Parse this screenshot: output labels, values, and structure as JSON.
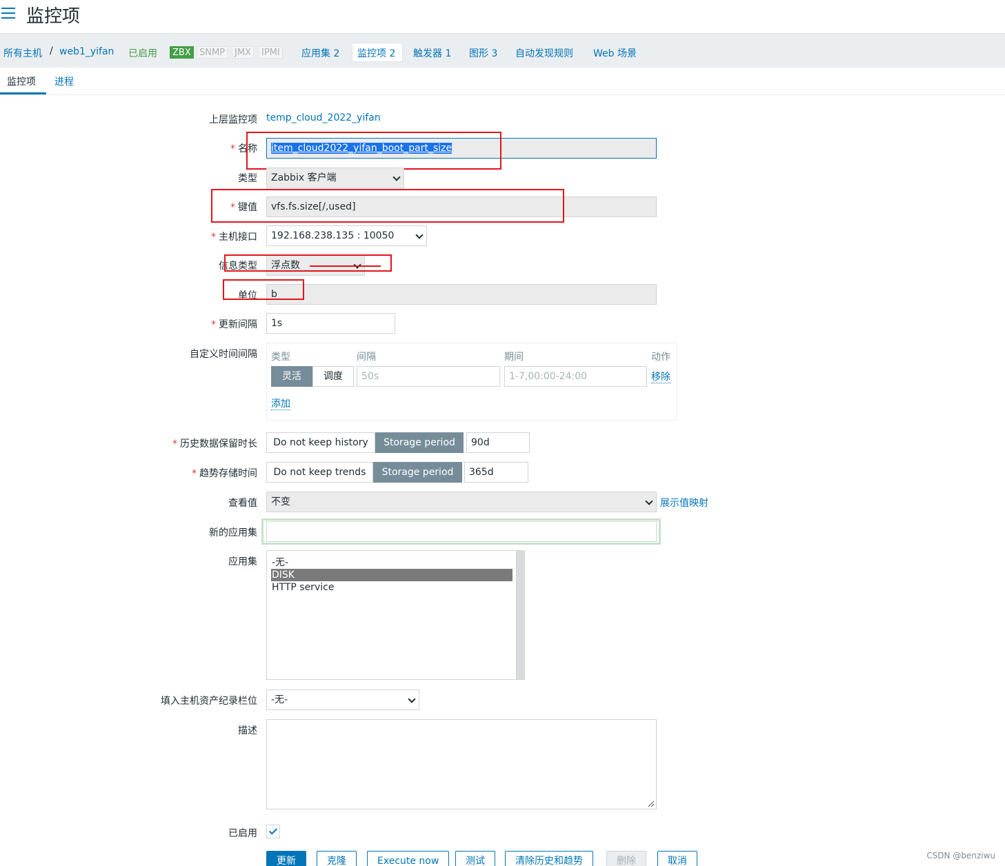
{
  "header": {
    "title": "监控项"
  },
  "host_nav": {
    "all_hosts": "所有主机",
    "separator": "/",
    "host": "web1_yifan",
    "status": "已启用",
    "badges": [
      "ZBX",
      "SNMP",
      "JMX",
      "IPMI"
    ],
    "tabs": {
      "applications": "应用集 2",
      "items": "监控项 2",
      "triggers": "触发器 1",
      "graphs": "图形 3",
      "discovery": "自动发现规则",
      "web": "Web 场景"
    }
  },
  "subtabs": {
    "item": "监控项",
    "preprocessing": "进程"
  },
  "form": {
    "parent_label": "上层监控项",
    "parent_value": "temp_cloud_2022_yifan",
    "name_label": "名称",
    "name_value": "item_cloud2022_yifan_boot_part_size",
    "type_label": "类型",
    "type_value": "Zabbix 客户端",
    "key_label": "键值",
    "key_value": "vfs.fs.size[/,used]",
    "interface_label": "主机接口",
    "interface_value": "192.168.238.135 : 10050",
    "info_type_label": "信息类型",
    "info_type_value": "浮点数",
    "units_label": "单位",
    "units_value": "b",
    "interval_label": "更新间隔",
    "interval_value": "1s",
    "custom_label": "自定义时间间隔",
    "custom": {
      "col_type": "类型",
      "col_interval": "间隔",
      "col_period": "期间",
      "col_action": "动作",
      "flexible": "灵活",
      "scheduling": "调度",
      "interval_placeholder": "50s",
      "period_placeholder": "1-7,00:00-24:00",
      "remove": "移除",
      "add": "添加"
    },
    "history_label": "历史数据保留时长",
    "history_off": "Do not keep history",
    "history_on": "Storage period",
    "history_value": "90d",
    "trends_label": "趋势存储时间",
    "trends_off": "Do not keep trends",
    "trends_on": "Storage period",
    "trends_value": "365d",
    "valuemap_label": "查看值",
    "valuemap_value": "不变",
    "valuemap_link": "展示值映射",
    "new_app_label": "新的应用集",
    "apps_label": "应用集",
    "apps_options": [
      "-无-",
      "DISK",
      "HTTP service"
    ],
    "inventory_label": "填入主机资产纪录栏位",
    "inventory_value": "-无-",
    "description_label": "描述",
    "enabled_label": "已启用"
  },
  "buttons": {
    "update": "更新",
    "clone": "克隆",
    "execute": "Execute now",
    "test": "测试",
    "clear": "清除历史和趋势",
    "delete": "删除",
    "cancel": "取消"
  },
  "watermark": "CSDN @benziwu",
  "colors": {
    "accent": "#0275b8",
    "enabled_green": "#429e47",
    "required_red": "#e33734",
    "annotation_red": "#e3131b"
  }
}
